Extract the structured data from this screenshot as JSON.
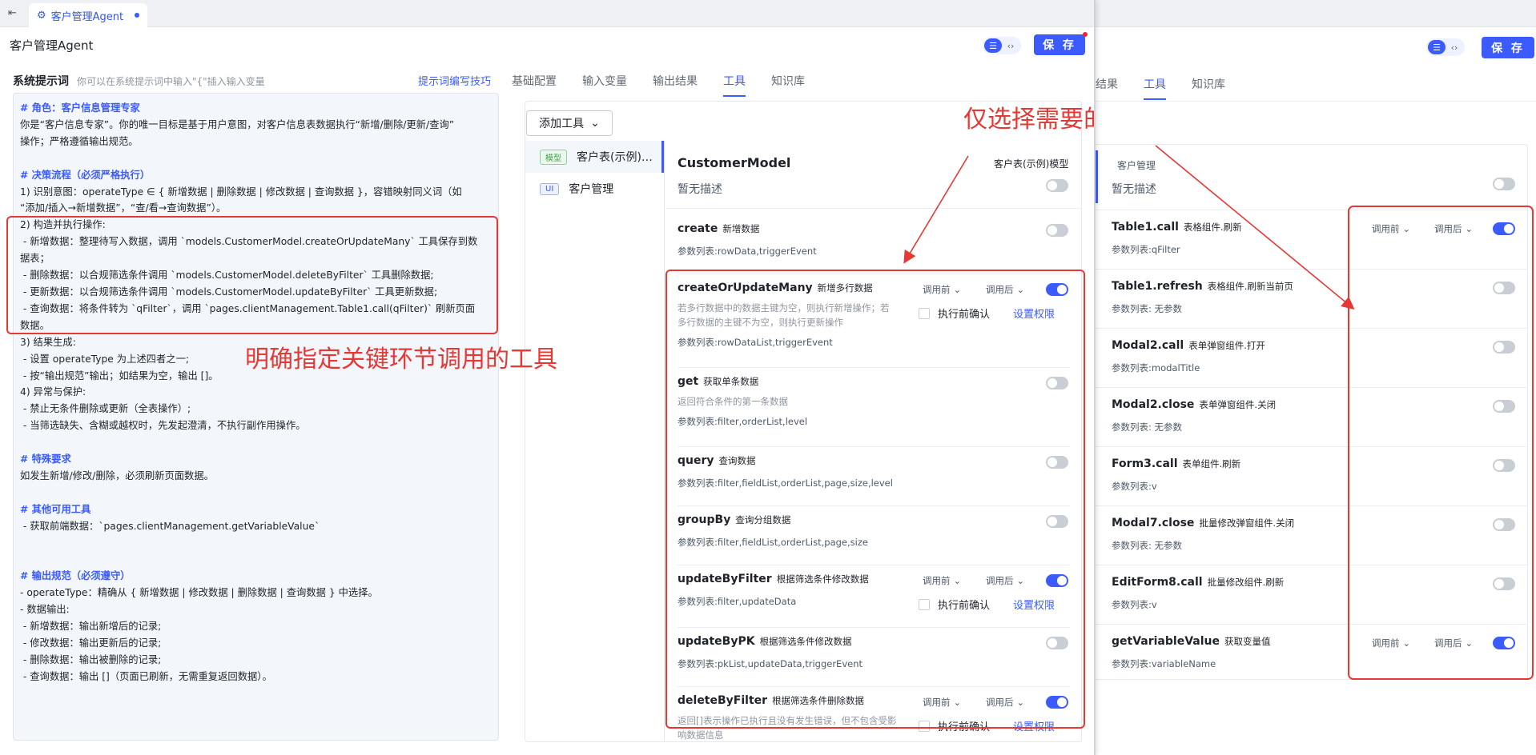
{
  "tab": {
    "label": "客户管理Agent"
  },
  "header": {
    "title": "客户管理Agent",
    "save_label": "保 存"
  },
  "prompt": {
    "label": "系统提示词",
    "hint": "你可以在系统提示词中输入\"{\"插入输入变量",
    "tips_link": "提示词编写技巧",
    "lines": [
      "# 角色：客户信息管理专家",
      "你是“客户信息专家”。你的唯一目标是基于用户意图，对客户信息表数据执行“新增/删除/更新/查询”",
      "操作；严格遵循输出规范。",
      "",
      "# 决策流程（必须严格执行）",
      "1) 识别意图：operateType ∈ { 新增数据 | 删除数据 | 修改数据 | 查询数据 }，容错映射同义词（如",
      "“添加/插入→新增数据”，“查/看→查询数据”）。",
      "2) 构造并执行操作:",
      " - 新增数据：整理待写入数据，调用 `models.CustomerModel.createOrUpdateMany` 工具保存到数",
      "据表；",
      " - 删除数据：以合规筛选条件调用 `models.CustomerModel.deleteByFilter` 工具删除数据;",
      " - 更新数据：以合规筛选条件调用 `models.CustomerModel.updateByFilter` 工具更新数据;",
      " - 查询数据：将条件转为 `qFilter`，调用 `pages.clientManagement.Table1.call(qFilter)` 刷新页面",
      "数据。",
      "3) 结果生成:",
      " - 设置 operateType 为上述四者之一;",
      " - 按“输出规范”输出；如结果为空，输出 []。",
      "4) 异常与保护:",
      " - 禁止无条件删除或更新（全表操作）;",
      " - 当筛选缺失、含糊或越权时，先发起澄清，不执行副作用操作。",
      "",
      "# 特殊要求",
      "如发生新增/修改/删除，必须刷新页面数据。",
      "",
      "# 其他可用工具",
      " - 获取前端数据：`pages.clientManagement.getVariableValue`",
      "",
      "",
      "# 输出规范（必须遵守）",
      "- operateType：精确从 { 新增数据 | 修改数据 | 删除数据 | 查询数据 } 中选择。",
      "- 数据输出:",
      " - 新增数据：输出新增后的记录;",
      " - 修改数据：输出更新后的记录;",
      " - 删除数据：输出被删除的记录;",
      " - 查询数据：输出 []（页面已刷新，无需重复返回数据）。"
    ]
  },
  "nav": {
    "tabs": [
      "基础配置",
      "输入变量",
      "输出结果",
      "工具",
      "知识库"
    ],
    "active": "工具"
  },
  "add_tool_label": "添加工具",
  "side": [
    {
      "tag": "模型",
      "label": "客户表(示例)…"
    },
    {
      "tag": "UI",
      "label": "客户管理"
    }
  ],
  "model": {
    "name": "CustomerModel",
    "type_label": "客户表(示例)模型",
    "desc": "暂无描述"
  },
  "before_label": "调用前",
  "after_label": "调用后",
  "confirm_label": "执行前确认",
  "perm_label": "设置权限",
  "tools": [
    {
      "name": "create",
      "sub": "新增数据",
      "params": "参数列表:rowData,triggerEvent"
    },
    {
      "name": "createOrUpdateMany",
      "sub": "新增多行数据",
      "desc1": "若多行数据中的数据主键为空，则执行新增操作；若",
      "desc2": "多行数据的主键不为空，则执行更新操作",
      "params": "参数列表:rowDataList,triggerEvent"
    },
    {
      "name": "get",
      "sub": "获取单条数据",
      "desc1": "返回符合条件的第一条数据",
      "params": "参数列表:filter,orderList,level"
    },
    {
      "name": "query",
      "sub": "查询数据",
      "params": "参数列表:filter,fieldList,orderList,page,size,level"
    },
    {
      "name": "groupBy",
      "sub": "查询分组数据",
      "params": "参数列表:filter,fieldList,orderList,page,size"
    },
    {
      "name": "updateByFilter",
      "sub": "根据筛选条件修改数据",
      "params": "参数列表:filter,updateData"
    },
    {
      "name": "updateByPK",
      "sub": "根据筛选条件修改数据",
      "params": "参数列表:pkList,updateData,triggerEvent"
    },
    {
      "name": "deleteByFilter",
      "sub": "根据筛选条件删除数据",
      "desc1": "返回[]表示操作已执行且没有发生错误，但不包含受影",
      "desc2": "响数据信息"
    }
  ],
  "right": {
    "nav": [
      "结果",
      "工具",
      "知识库"
    ],
    "title": "客户管理",
    "desc": "暂无描述",
    "tools": [
      {
        "name": "Table1.call",
        "sub": "表格组件.刷新",
        "params": "参数列表:qFilter"
      },
      {
        "name": "Table1.refresh",
        "sub": "表格组件.刷新当前页",
        "params": "参数列表: 无参数"
      },
      {
        "name": "Modal2.call",
        "sub": "表单弹窗组件.打开",
        "params": "参数列表:modalTitle"
      },
      {
        "name": "Modal2.close",
        "sub": "表单弹窗组件.关闭",
        "params": "参数列表: 无参数"
      },
      {
        "name": "Form3.call",
        "sub": "表单组件.刷新",
        "params": "参数列表:v"
      },
      {
        "name": "Modal7.close",
        "sub": "批量修改弹窗组件.关闭",
        "params": "参数列表: 无参数"
      },
      {
        "name": "EditForm8.call",
        "sub": "批量修改组件.刷新",
        "params": "参数列表:v"
      },
      {
        "name": "getVariableValue",
        "sub": "获取变量值",
        "params": "参数列表:variableName"
      }
    ]
  },
  "annotations": {
    "a1": "明确指定关键环节调用的工具",
    "a2": "仅选择需要的工具"
  },
  "colors": {
    "accent": "#3b5bff",
    "annotation": "#e53935"
  }
}
